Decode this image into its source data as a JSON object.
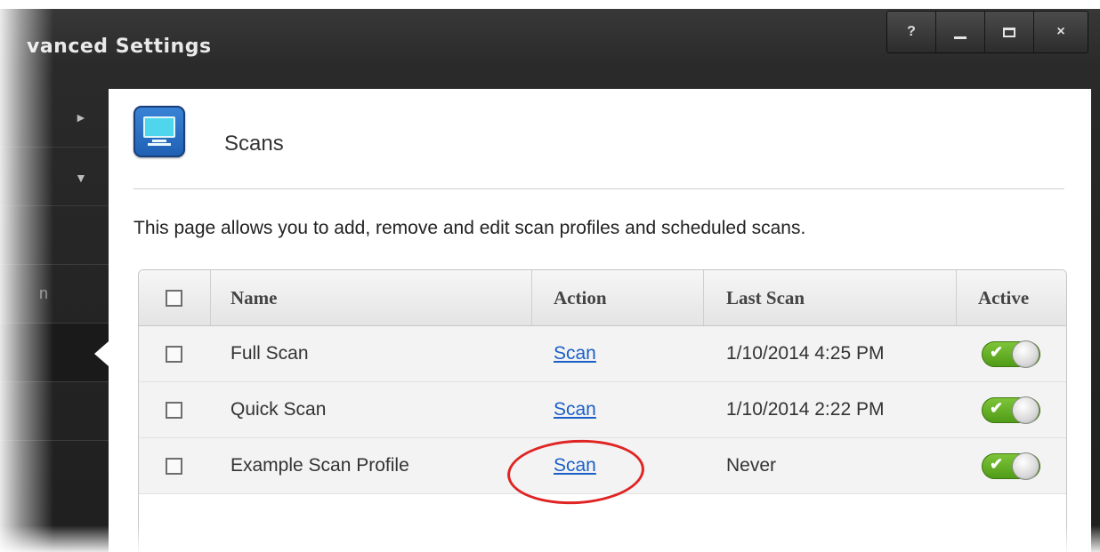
{
  "window": {
    "title": "vanced Settings",
    "buttons": {
      "help": "?",
      "minimize": "",
      "maximize": "",
      "close": "×"
    }
  },
  "sidebar": {
    "items": [
      {
        "arrow": "►",
        "label": ""
      },
      {
        "arrow": "▼",
        "label": ""
      },
      {
        "arrow": "",
        "label": ""
      },
      {
        "arrow": "",
        "label": "n"
      },
      {
        "arrow": "",
        "label": "",
        "selected": true
      },
      {
        "arrow": "",
        "label": ""
      }
    ]
  },
  "page": {
    "title": "Scans",
    "description": "This page allows you to add, remove and edit scan profiles and scheduled scans."
  },
  "table": {
    "columns": [
      "Name",
      "Action",
      "Last Scan",
      "Active"
    ],
    "rows": [
      {
        "name": "Full Scan",
        "action": "Scan",
        "last_scan": "1/10/2014 4:25 PM",
        "active": true
      },
      {
        "name": "Quick Scan",
        "action": "Scan",
        "last_scan": "1/10/2014 2:22 PM",
        "active": true
      },
      {
        "name": "Example Scan Profile",
        "action": "Scan",
        "last_scan": "Never",
        "active": true
      }
    ],
    "toggle_check": "✔"
  },
  "colors": {
    "accent_link": "#1a5fc7",
    "toggle_on": "#5aa81f",
    "annotation": "#e02424"
  }
}
